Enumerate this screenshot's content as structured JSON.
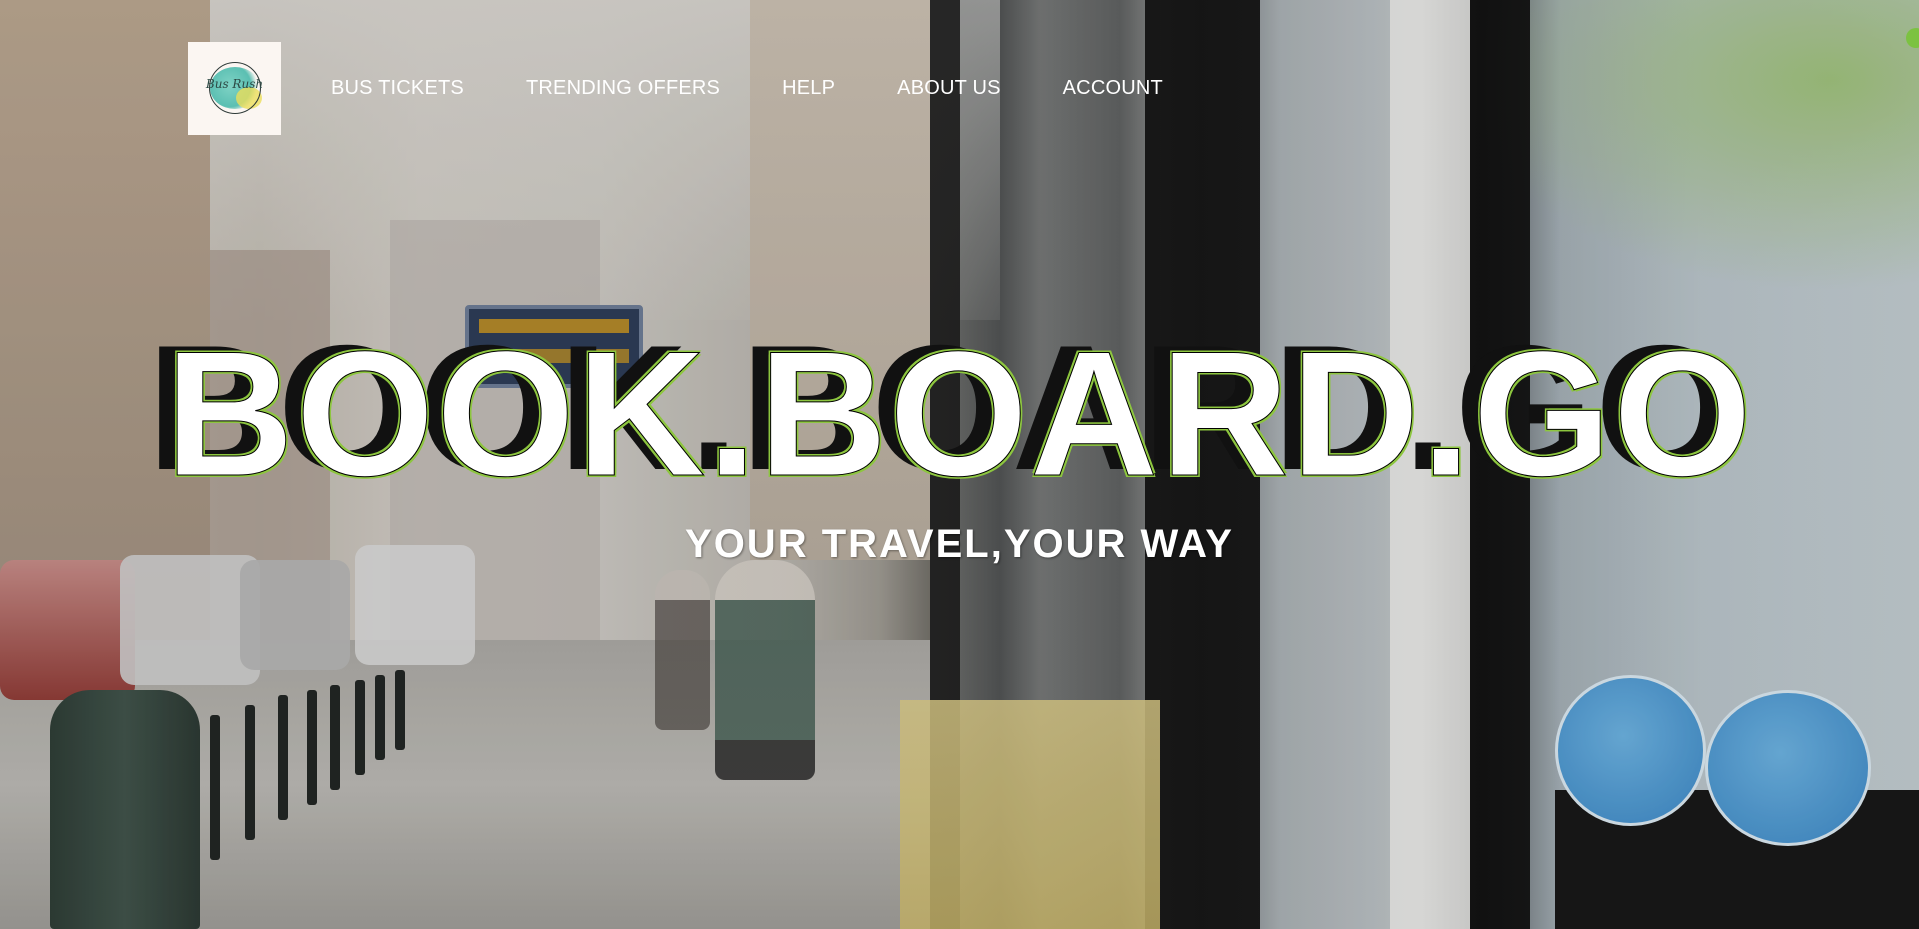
{
  "brand": {
    "logo_text": "Bus Rush",
    "logo_icon": "bus-rush-logo"
  },
  "nav": {
    "items": [
      {
        "label": "BUS TICKETS"
      },
      {
        "label": "TRENDING OFFERS"
      },
      {
        "label": "HELP"
      },
      {
        "label": "ABOUT US"
      },
      {
        "label": "ACCOUNT"
      }
    ]
  },
  "hero": {
    "headline": "BOOK.BOARD.GO",
    "tagline": "YOUR TRAVEL,YOUR WAY",
    "background": "blurred-city-street-with-tram-photo"
  },
  "colors": {
    "accent": "#8dc63f",
    "text": "#ffffff",
    "headline_shadow": "#111111"
  }
}
